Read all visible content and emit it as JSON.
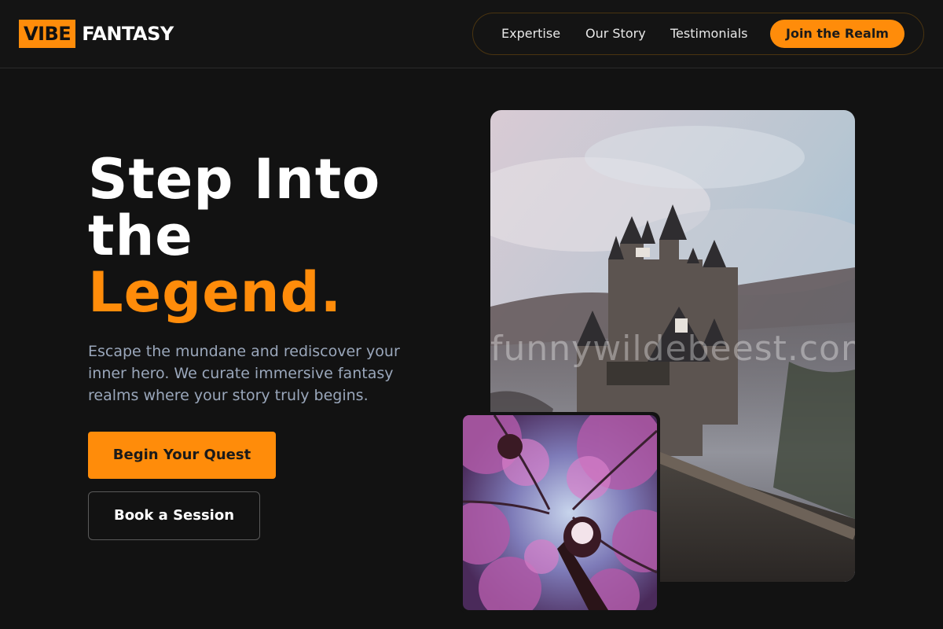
{
  "brand": {
    "logo_box": "VIBE",
    "logo_text": "FANTASY",
    "accent_color": "#ff8c0a"
  },
  "nav": {
    "links": [
      "Expertise",
      "Our Story",
      "Testimonials"
    ],
    "cta": "Join the Realm"
  },
  "hero": {
    "title_line1": "Step Into",
    "title_line2": "the",
    "title_accent": "Legend.",
    "description": "Escape the mundane and rediscover your inner hero. We curate immersive fantasy realms where your story truly begins.",
    "primary_button": "Begin Your Quest",
    "secondary_button": "Book a Session"
  },
  "images": {
    "main": "castle-photo",
    "secondary": "pink-trees-lantern-photo",
    "watermark": "funnywildebeest.com"
  }
}
